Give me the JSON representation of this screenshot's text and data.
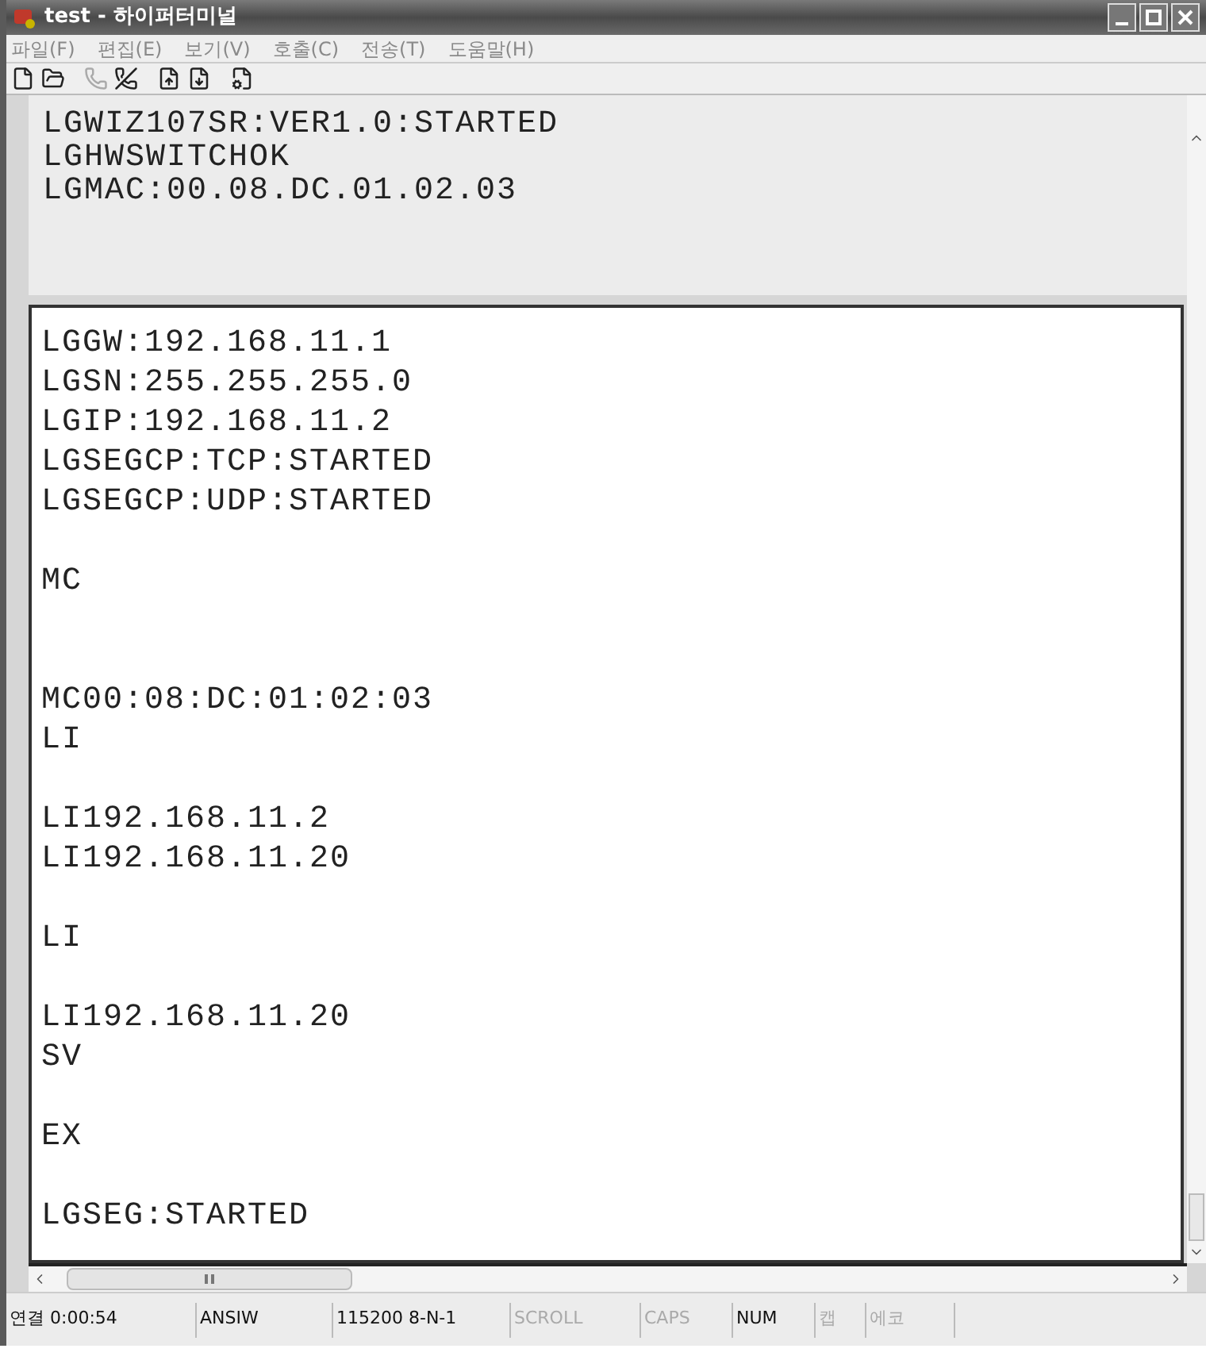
{
  "window": {
    "title": "test - 하이퍼터미널"
  },
  "menu": [
    "파일(F)",
    "편집(E)",
    "보기(V)",
    "호출(C)",
    "전송(T)",
    "도움말(H)"
  ],
  "toolbar": [
    {
      "kind": "new"
    },
    {
      "kind": "open"
    },
    {
      "kind": "phone",
      "disabled": true
    },
    {
      "kind": "disconnect",
      "disabled": false
    },
    {
      "kind": "send"
    },
    {
      "kind": "receive"
    },
    {
      "kind": "properties"
    }
  ],
  "scrollback": [
    "LGWIZ107SR:VER1.0:STARTED",
    "LGHWSWITCHOK",
    "LGMAC:00.08.DC.01.02.03"
  ],
  "terminal": [
    {
      "kind": "text",
      "text": "LGGW:192.168.11.1"
    },
    {
      "kind": "text",
      "text": "LGSN:255.255.255.0"
    },
    {
      "kind": "text",
      "text": "LGIP:192.168.11.2"
    },
    {
      "kind": "text",
      "text": "LGSEGCP:TCP:STARTED"
    },
    {
      "kind": "text",
      "text": "LGSEGCP:UDP:STARTED"
    },
    {
      "kind": "blank"
    },
    {
      "kind": "text",
      "text": "MC"
    },
    {
      "kind": "blank"
    },
    {
      "kind": "blank"
    },
    {
      "kind": "text",
      "text": "MC00:08:DC:01:02:03"
    },
    {
      "kind": "text",
      "text": "LI"
    },
    {
      "kind": "blank"
    },
    {
      "kind": "text",
      "text": "LI192.168.11.2"
    },
    {
      "kind": "text",
      "text": "LI192.168.11.20"
    },
    {
      "kind": "blank"
    },
    {
      "kind": "text",
      "text": "LI"
    },
    {
      "kind": "blank"
    },
    {
      "kind": "text",
      "text": "LI192.168.11.20"
    },
    {
      "kind": "text",
      "text": "SV"
    },
    {
      "kind": "blank"
    },
    {
      "kind": "text",
      "text": "EX"
    },
    {
      "kind": "blank"
    },
    {
      "kind": "text",
      "text": "LGSEG:STARTED"
    }
  ],
  "status_bar": [
    {
      "text": "연결 0:00:54",
      "on": true
    },
    {
      "text": "ANSIW",
      "on": true
    },
    {
      "text": "115200 8-N-1",
      "on": true
    },
    {
      "text": "SCROLL",
      "on": false
    },
    {
      "text": "CAPS",
      "on": false
    },
    {
      "text": "NUM",
      "on": true
    },
    {
      "text": "캡",
      "on": false
    },
    {
      "text": "에코",
      "on": false
    }
  ]
}
